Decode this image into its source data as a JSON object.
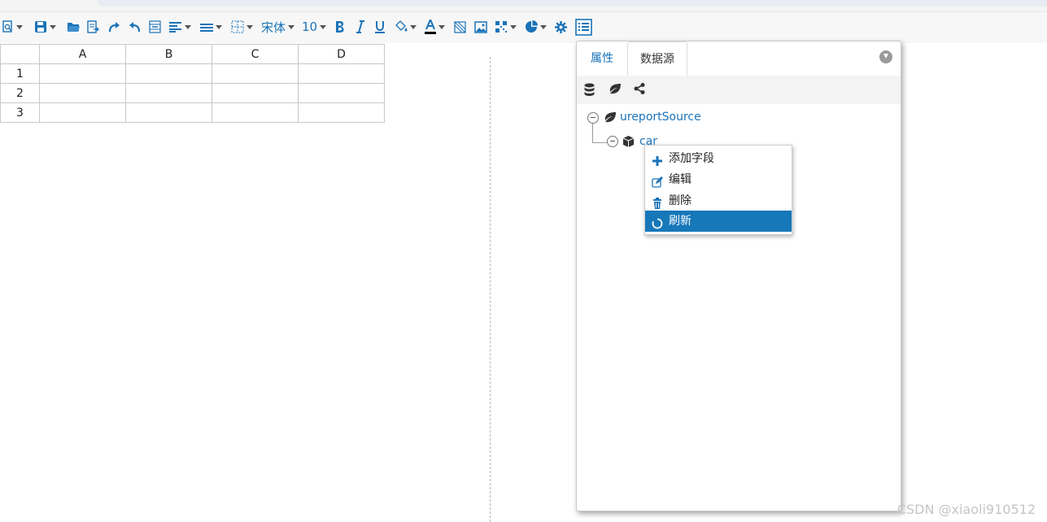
{
  "toolbar": {
    "font_name": "宋体",
    "font_size": "10",
    "colors": {
      "icon": "#1a73b8",
      "accent": "#1677b9"
    },
    "icons": [
      "preview-icon",
      "save-icon",
      "open-folder-icon",
      "import-icon",
      "redo-icon",
      "undo-icon",
      "merge-cells-icon",
      "align-icon",
      "valign-icon",
      "border-icon",
      "bold-icon",
      "italic-icon",
      "underline-icon",
      "fill-color-icon",
      "font-color-icon",
      "no-border-icon",
      "image-icon",
      "qrcode-icon",
      "chart-icon",
      "settings-icon",
      "list-icon"
    ]
  },
  "sheet": {
    "columns": [
      "A",
      "B",
      "C",
      "D"
    ],
    "rows": [
      "1",
      "2",
      "3"
    ]
  },
  "panel": {
    "tabs": [
      "属性",
      "数据源"
    ],
    "active_tab": "数据源",
    "tree": {
      "root": "ureportSource",
      "child": "car"
    }
  },
  "context_menu": {
    "items": [
      {
        "label": "添加字段",
        "icon": "plus-icon"
      },
      {
        "label": "编辑",
        "icon": "edit-icon"
      },
      {
        "label": "删除",
        "icon": "trash-icon"
      },
      {
        "label": "刷新",
        "icon": "refresh-icon",
        "selected": true
      }
    ]
  },
  "watermark": "CSDN @xiaoli910512"
}
